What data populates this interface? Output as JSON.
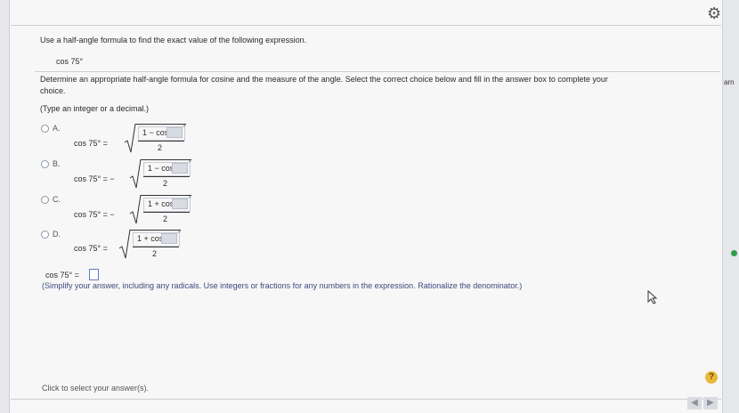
{
  "header": {
    "settings_icon": "gear-icon"
  },
  "question": {
    "instruction": "Use a half-angle formula to find the exact value of the following expression.",
    "expression": "cos 75°",
    "task": "Determine an appropriate half-angle formula for cosine and the measure of the angle. Select the correct choice below and fill in the answer box to complete your",
    "task_cont": "choice.",
    "type_hint": "(Type an integer or a decimal.)"
  },
  "choices": [
    {
      "label": "A.",
      "lhs": "cos 75° =",
      "sign": "",
      "num": "1 − cos",
      "den": "2"
    },
    {
      "label": "B.",
      "lhs": "cos 75° =",
      "sign": "−",
      "num": "1 − cos",
      "den": "2"
    },
    {
      "label": "C.",
      "lhs": "cos 75° =",
      "sign": "−",
      "num": "1 + cos",
      "den": "2"
    },
    {
      "label": "D.",
      "lhs": "cos 75° =",
      "sign": "",
      "num": "1 + cos",
      "den": "2"
    }
  ],
  "answer": {
    "lhs": "cos 75° =",
    "hint": "(Simplify your answer, including any radicals. Use integers or fractions for any numbers in the expression. Rationalize the denominator.)"
  },
  "footer": {
    "click_text": "Click to select your answer(s).",
    "help": "?",
    "prev": "◀",
    "next": "▶"
  },
  "side": {
    "text": "arn"
  }
}
